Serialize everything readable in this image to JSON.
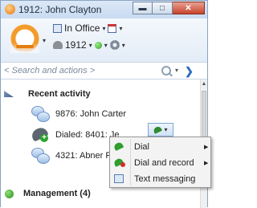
{
  "window": {
    "title": "1912: John Clayton",
    "minimize_glyph": "▬",
    "maximize_glyph": "□",
    "close_glyph": "✕"
  },
  "header": {
    "presence": "In Office",
    "extension": "1912",
    "dropdown_glyph": "▾"
  },
  "search": {
    "placeholder": "< Search and actions >",
    "dropdown_glyph": "▾",
    "favorites_glyph": "❯"
  },
  "sections": {
    "recent": {
      "label": "Recent activity"
    },
    "management": {
      "label": "Management (4)"
    }
  },
  "recent_items": [
    {
      "label": "9876: John Carter",
      "icon": "chat-bubbles-icon"
    },
    {
      "label": "Dialed: 8401: Je",
      "icon": "outgoing-call-icon"
    },
    {
      "label": "4321: Abner Pe",
      "icon": "chat-bubbles-icon"
    }
  ],
  "context_menu": {
    "items": [
      {
        "label": "Dial",
        "has_submenu": true,
        "icon": "dial-phone-icon"
      },
      {
        "label": "Dial and record",
        "has_submenu": true,
        "icon": "dial-record-icon"
      },
      {
        "label": "Text messaging",
        "has_submenu": false,
        "icon": "text-message-icon"
      }
    ],
    "submenu_glyph": "▶"
  },
  "scrollbar": {
    "up_glyph": "▲"
  },
  "colors": {
    "accent_orange": "#f39b2a",
    "presence_green": "#2e9e1f",
    "title_blue": "#c8dbf1"
  }
}
